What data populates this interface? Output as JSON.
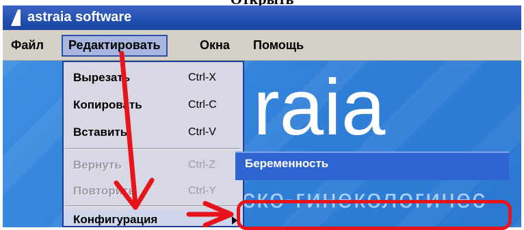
{
  "page_heading": {
    "text": "Открыть"
  },
  "titlebar": {
    "title": "astraia software",
    "logo_icon": "astraia-logo-icon"
  },
  "menubar": {
    "items": [
      {
        "label": "Файл",
        "active": false
      },
      {
        "label": "Редактировать",
        "active": true
      },
      {
        "label": "Окна",
        "active": false
      },
      {
        "label": "Помощь",
        "active": false
      }
    ]
  },
  "edit_menu": {
    "items": [
      {
        "label": "Вырезать",
        "shortcut": "Ctrl-X",
        "enabled": true
      },
      {
        "label": "Копировать",
        "shortcut": "Ctrl-C",
        "enabled": true
      },
      {
        "label": "Вставить",
        "shortcut": "Ctrl-V",
        "enabled": true
      },
      {
        "label": "Вернуть",
        "shortcut": "Ctrl-Z",
        "enabled": false
      },
      {
        "label": "Повторить",
        "shortcut": "Ctrl-Y",
        "enabled": false
      },
      {
        "label": "Конфигурация",
        "shortcut": "",
        "enabled": true,
        "has_submenu": true
      }
    ]
  },
  "submenu": {
    "items": [
      {
        "label": "Беременность"
      }
    ]
  },
  "background": {
    "logo_text": "raia",
    "subtitle_text": "ско-гинекологичес"
  },
  "colors": {
    "titlebar": "#2250b0",
    "menubar": "#d4d0c8",
    "menu_background": "#d8d7e4",
    "submenu_highlight": "#2f63d0",
    "annotation_red": "#e8141b",
    "splash_blue": "#3287dc"
  }
}
